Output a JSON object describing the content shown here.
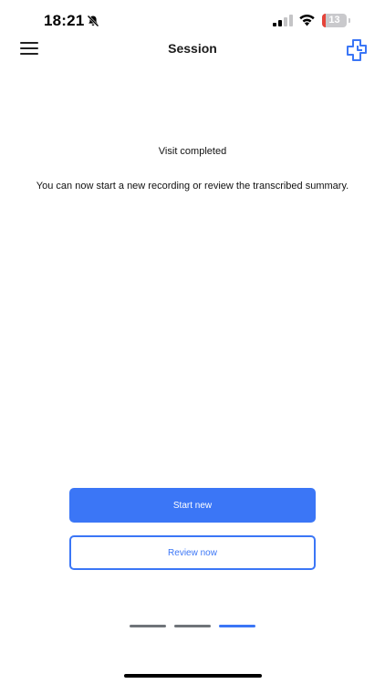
{
  "status_bar": {
    "time": "18:21",
    "battery_level": "13",
    "battery_fraction": 0.13,
    "icons": [
      "bell-muted-icon",
      "cellular-signal-icon",
      "wifi-icon",
      "battery-icon"
    ]
  },
  "nav": {
    "title": "Session",
    "menu_icon": "hamburger-menu-icon",
    "action_icon": "medical-cross-icon",
    "accent": "#3b76f6"
  },
  "content": {
    "headline": "Visit completed",
    "message": "You can now start a new recording or review the transcribed summary."
  },
  "actions": {
    "start_new_label": "Start new",
    "review_now_label": "Review now"
  },
  "pager": {
    "total": 3,
    "active_index": 2,
    "active_color": "#3b76f6",
    "inactive_color": "#6f7479"
  }
}
